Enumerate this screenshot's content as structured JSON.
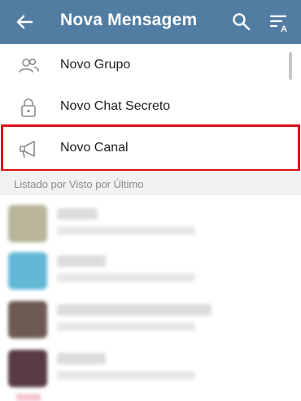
{
  "header": {
    "title": "Nova Mensagem",
    "back_icon": "arrow-left-icon",
    "search_icon": "search-icon",
    "sort_icon": "sort-alpha-icon",
    "background": "#527da3"
  },
  "menu": {
    "items": [
      {
        "label": "Novo Grupo",
        "icon": "group-icon"
      },
      {
        "label": "Novo Chat Secreto",
        "icon": "lock-icon"
      },
      {
        "label": "Novo Canal",
        "icon": "megaphone-icon",
        "highlighted": true
      }
    ],
    "highlight_color": "#e0101a"
  },
  "contacts_section": {
    "header": "Listado por Visto por Último",
    "contacts": [
      {
        "name": "",
        "status": "",
        "avatar_color": "#b8b59a"
      },
      {
        "name": "",
        "status": "",
        "avatar_color": "#63b8d6"
      },
      {
        "name": "",
        "status": "",
        "avatar_color": "#6e5a52"
      },
      {
        "name": "",
        "status": "",
        "avatar_color": "#5a3a45"
      }
    ]
  }
}
